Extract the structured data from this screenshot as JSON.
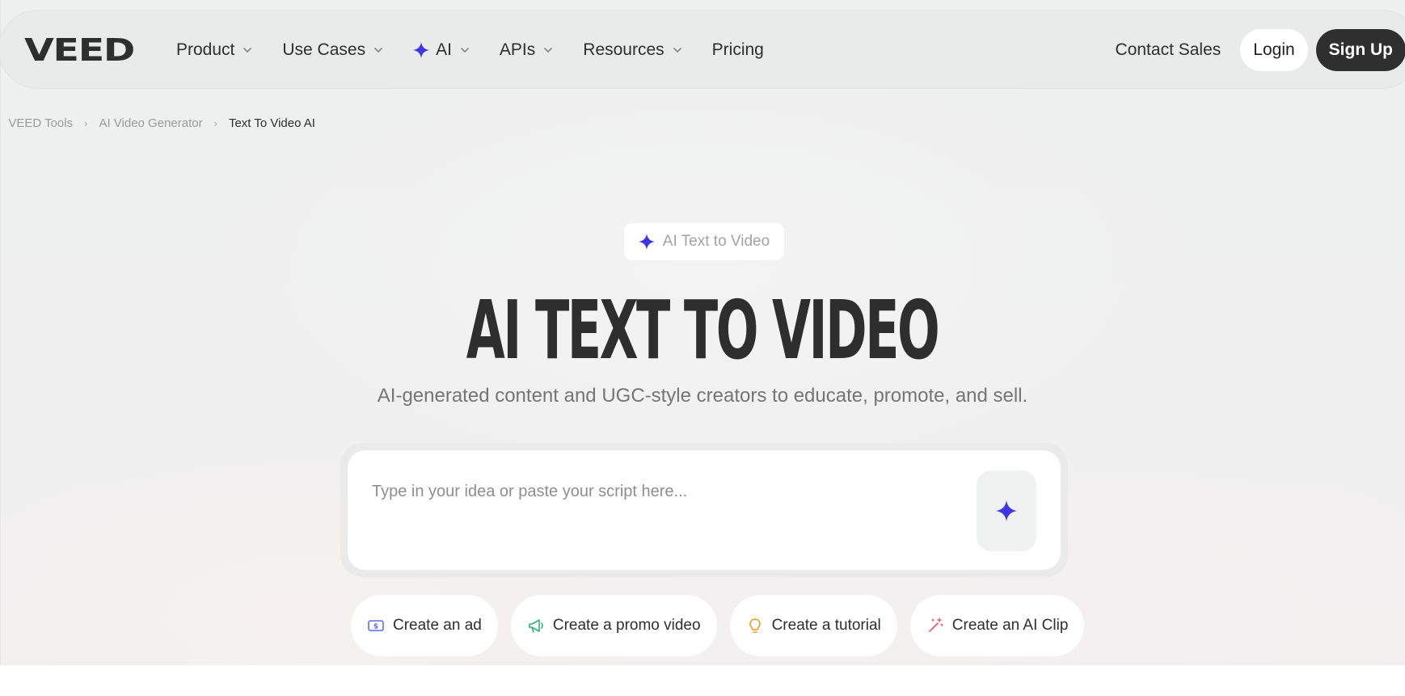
{
  "brand": {
    "logo_text": "VEED"
  },
  "nav": {
    "items": [
      {
        "label": "Product",
        "has_dropdown": true
      },
      {
        "label": "Use Cases",
        "has_dropdown": true
      },
      {
        "label": "AI",
        "has_dropdown": true,
        "icon": "sparkle-icon"
      },
      {
        "label": "APIs",
        "has_dropdown": true
      },
      {
        "label": "Resources",
        "has_dropdown": true
      },
      {
        "label": "Pricing",
        "has_dropdown": false
      }
    ],
    "contact_label": "Contact Sales",
    "login_label": "Login",
    "signup_label": "Sign Up"
  },
  "breadcrumb": {
    "items": [
      "VEED Tools",
      "AI Video Generator",
      "Text To Video AI"
    ]
  },
  "hero": {
    "badge": "AI Text to Video",
    "title": "AI TEXT TO VIDEO",
    "subtitle": "AI-generated content and UGC-style creators to educate, promote, and sell."
  },
  "prompt": {
    "placeholder": "Type in your idea or paste your script here...",
    "value": ""
  },
  "chips": [
    {
      "label": "Create an ad",
      "icon": "dollar-bill-icon",
      "color": "#5b6cf0"
    },
    {
      "label": "Create a promo video",
      "icon": "megaphone-icon",
      "color": "#2fb37a"
    },
    {
      "label": "Create a tutorial",
      "icon": "lightbulb-icon",
      "color": "#f29a1c"
    },
    {
      "label": "Create an AI Clip",
      "icon": "magic-wand-icon",
      "color": "#ef5a6a"
    }
  ],
  "colors": {
    "accent": "#3d35e8",
    "dark": "#2f2f2f",
    "background": "#eeefef"
  }
}
